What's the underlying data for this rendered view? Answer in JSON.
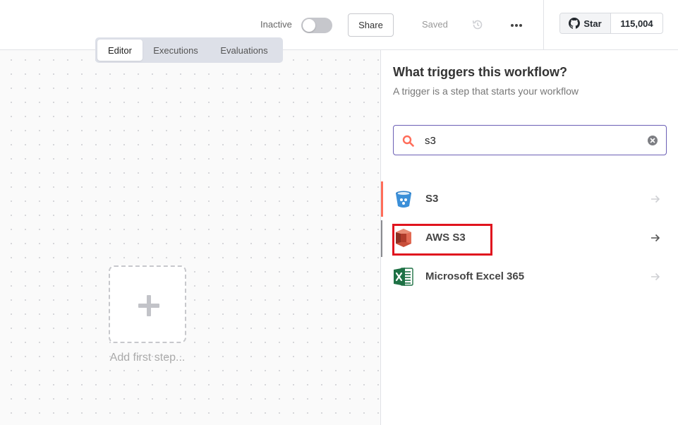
{
  "header": {
    "status_label": "Inactive",
    "active": false,
    "share_label": "Share",
    "saved_label": "Saved",
    "github": {
      "star_label": "Star",
      "star_count": "115,004"
    }
  },
  "tabs": [
    {
      "label": "Editor",
      "active": true
    },
    {
      "label": "Executions",
      "active": false
    },
    {
      "label": "Evaluations",
      "active": false
    }
  ],
  "canvas": {
    "add_label": "Add first step..."
  },
  "panel": {
    "title": "What triggers this workflow?",
    "subtitle": "A trigger is a step that starts your workflow",
    "search": {
      "value": "s3"
    },
    "results": [
      {
        "label": "S3",
        "icon": "s3-bucket-icon",
        "selected": true
      },
      {
        "label": "AWS S3",
        "icon": "aws-s3-icon",
        "selected": false
      },
      {
        "label": "Microsoft Excel 365",
        "icon": "excel-icon",
        "selected": false
      }
    ]
  },
  "colors": {
    "accent": "#ff6d5a",
    "search_border": "#6b5fb5",
    "highlight": "#e0141e"
  }
}
